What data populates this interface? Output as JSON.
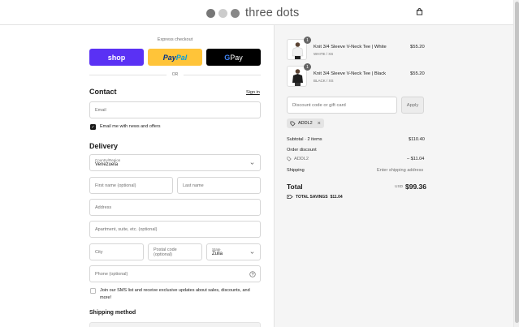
{
  "header": {
    "brand": "three dots",
    "colors": {
      "dot1": "#777777",
      "dot2": "#cccccc",
      "dot3": "#888888"
    },
    "cart_icon": "shopping-bag-icon"
  },
  "express": {
    "label": "Express checkout",
    "shop_label": "shop",
    "paypal_part1": "Pay",
    "paypal_part2": "Pal",
    "gpay_g": "G",
    "gpay_text": " Pay",
    "or": "OR"
  },
  "contact": {
    "title": "Contact",
    "sign_in": "Sign in",
    "email_placeholder": "Email",
    "newsletter_label": "Email me with news and offers",
    "newsletter_checked": true
  },
  "delivery": {
    "title": "Delivery",
    "country_label": "Country/Region",
    "country_value": "Venezuela",
    "first_name_placeholder": "First name (optional)",
    "last_name_placeholder": "Last name",
    "address_placeholder": "Address",
    "apartment_placeholder": "Apartment, suite, etc. (optional)",
    "city_placeholder": "City",
    "postal_placeholder": "Postal code (optional)",
    "state_label": "State",
    "state_value": "Zulia",
    "phone_placeholder": "Phone (optional)",
    "sms_label_line1": "Join our SMS list and receive exclusive updates about sales, discounts, and",
    "sms_label_line2": "more!",
    "sms_checked": false
  },
  "shipping_method": {
    "title": "Shipping method"
  },
  "cart": {
    "items": [
      {
        "name": "Knit 3/4 Sleeve V-Neck Tee | White",
        "variant": "WHITE / XS",
        "price": "$55.20",
        "qty": "1",
        "shirt_color": "#f2f2f2"
      },
      {
        "name": "Knit 3/4 Sleeve V-Neck Tee | Black",
        "variant": "BLACK / XS",
        "price": "$55.20",
        "qty": "1",
        "shirt_color": "#1e1e1e"
      }
    ],
    "discount_placeholder": "Discount code or gift card",
    "apply_label": "Apply",
    "applied_code": "ADDL2",
    "subtotal_label": "Subtotal · 2 items",
    "subtotal_value": "$110.40",
    "order_discount_label": "Order discount",
    "order_discount_code": "ADDL2",
    "order_discount_value": "– $11.04",
    "shipping_label": "Shipping",
    "shipping_value": "Enter shipping address",
    "total_label": "Total",
    "total_currency": "USD",
    "total_value": "$99.36",
    "savings_label": "TOTAL SAVINGS",
    "savings_value": "$11.04"
  }
}
